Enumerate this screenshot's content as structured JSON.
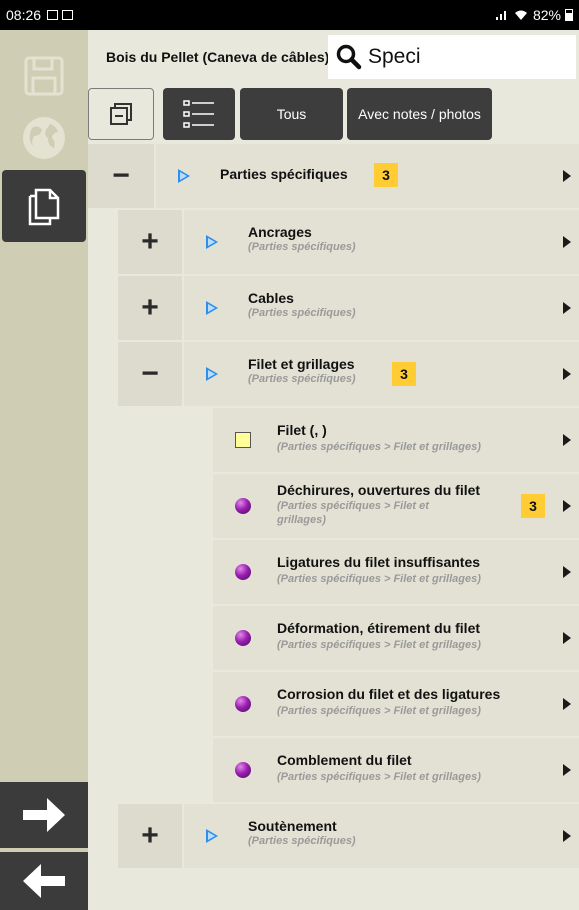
{
  "status": {
    "time": "08:26",
    "right_text": "82%"
  },
  "header": {
    "title": "Bois du Pellet (Caneva de câbles)"
  },
  "search": {
    "value": "Speci"
  },
  "toolbar": {
    "btn_all": "Tous",
    "btn_notes": "Avec notes / photos"
  },
  "tree": {
    "items": [
      {
        "toggle": "−",
        "label": "Parties spécifiques",
        "sub": "",
        "badge": "3"
      },
      {
        "toggle": "+",
        "label": "Ancrages",
        "sub": "(Parties spécifiques)",
        "badge": ""
      },
      {
        "toggle": "+",
        "label": "Cables",
        "sub": "(Parties spécifiques)",
        "badge": ""
      },
      {
        "toggle": "−",
        "label": "Filet et grillages",
        "sub": "(Parties spécifiques)",
        "badge": "3"
      },
      {
        "toggle": "",
        "label": "Filet (, )",
        "sub": "(Parties spécifiques > Filet et grillages)",
        "badge": ""
      },
      {
        "toggle": "",
        "label": "Déchirures, ouvertures du filet",
        "sub": "(Parties spécifiques > Filet et grillages)",
        "badge": "3"
      },
      {
        "toggle": "",
        "label": "Ligatures du filet insuffisantes",
        "sub": "(Parties spécifiques > Filet et grillages)",
        "badge": ""
      },
      {
        "toggle": "",
        "label": "Déformation, étirement du filet",
        "sub": "(Parties spécifiques > Filet et grillages)",
        "badge": ""
      },
      {
        "toggle": "",
        "label": "Corrosion du filet et des ligatures",
        "sub": "(Parties spécifiques > Filet et grillages)",
        "badge": ""
      },
      {
        "toggle": "",
        "label": "Comblement du filet",
        "sub": "(Parties spécifiques > Filet et grillages)",
        "badge": ""
      },
      {
        "toggle": "+",
        "label": "Soutènement",
        "sub": "(Parties spécifiques)",
        "badge": ""
      }
    ]
  }
}
